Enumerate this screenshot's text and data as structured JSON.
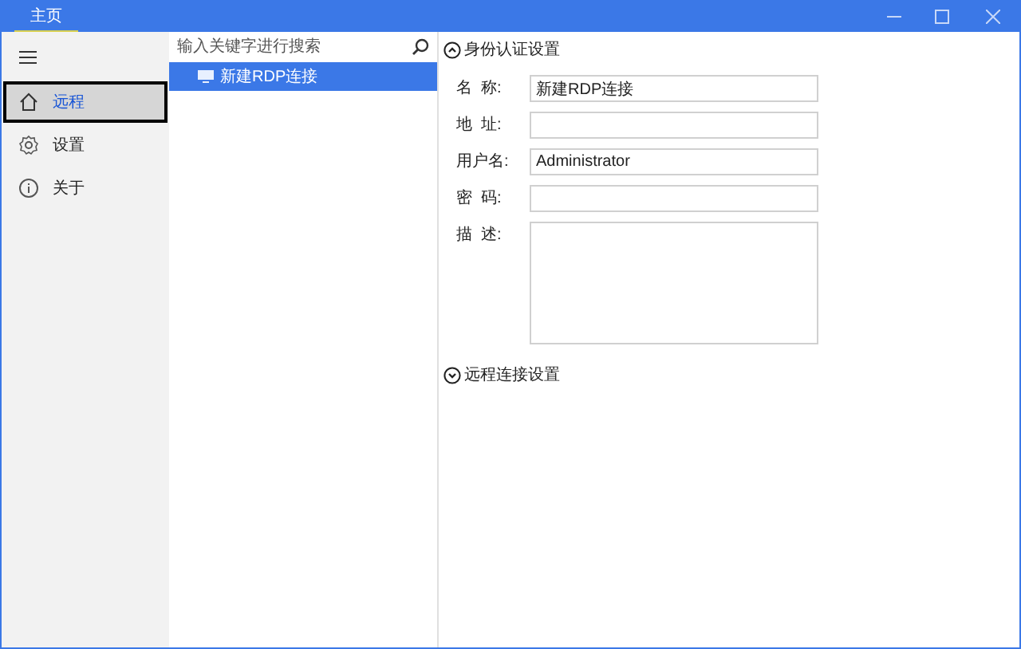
{
  "window": {
    "tabs": [
      {
        "label": "主页",
        "selected": true
      }
    ]
  },
  "nav": {
    "items": [
      {
        "label": "远程",
        "kind": "home",
        "selected": true
      },
      {
        "label": "设置",
        "kind": "gear",
        "selected": false
      },
      {
        "label": "关于",
        "kind": "info",
        "selected": false
      }
    ]
  },
  "search": {
    "placeholder": "输入关键字进行搜索"
  },
  "connections": [
    {
      "label": "新建RDP连接",
      "selected": true
    }
  ],
  "sections": [
    {
      "title": "身份认证设置",
      "expanded": true,
      "fields": [
        {
          "label": "名  称:",
          "value": "新建RDP连接",
          "kind": "text"
        },
        {
          "label": "地  址:",
          "kind": "text"
        },
        {
          "label": "用户名:",
          "value": "Administrator",
          "kind": "text"
        },
        {
          "label": "密  码:",
          "kind": "password"
        },
        {
          "label": "描  述:",
          "kind": "textarea"
        }
      ]
    },
    {
      "title": "远程连接设置",
      "expanded": false
    }
  ]
}
